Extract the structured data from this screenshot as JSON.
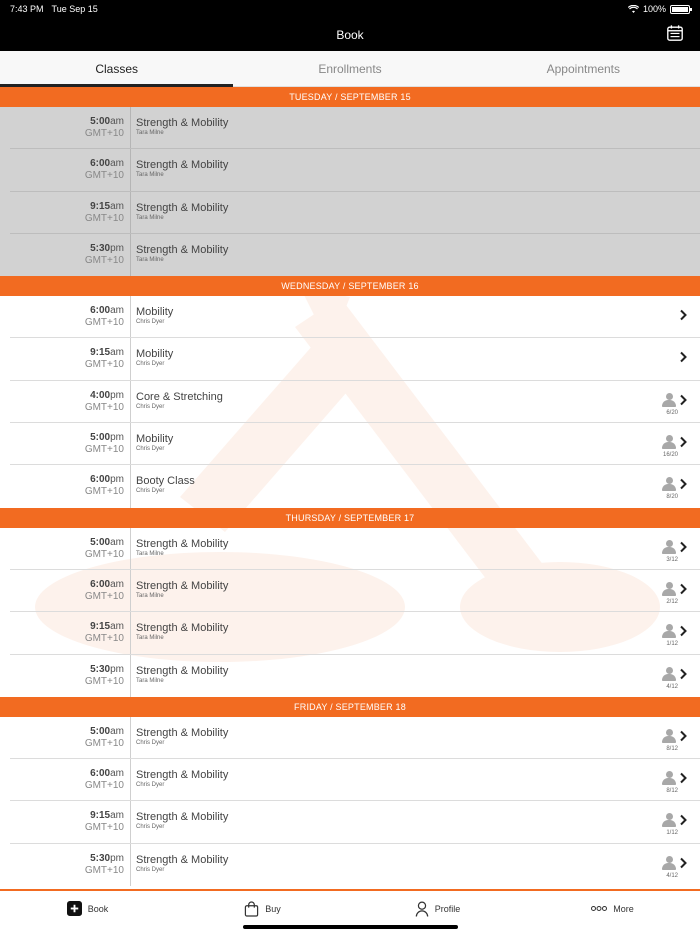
{
  "status_bar": {
    "time": "7:43 PM",
    "date": "Tue Sep 15",
    "battery": "100%"
  },
  "nav": {
    "title": "Book",
    "calendar_icon": "calendar-icon"
  },
  "tabs": [
    {
      "label": "Classes",
      "active": true
    },
    {
      "label": "Enrollments",
      "active": false
    },
    {
      "label": "Appointments",
      "active": false
    }
  ],
  "colors": {
    "accent": "#f26b21",
    "past_bg": "#d2d2d2",
    "bar_bg": "#000000"
  },
  "days": [
    {
      "header": "TUESDAY / SEPTEMBER 15",
      "past": true,
      "classes": [
        {
          "time": "5:00",
          "ampm": "am",
          "tz": "GMT+10",
          "name": "Strength & Mobility",
          "instructor": "Tara Milne",
          "show_person": false,
          "show_chevron": false,
          "count": ""
        },
        {
          "time": "6:00",
          "ampm": "am",
          "tz": "GMT+10",
          "name": "Strength & Mobility",
          "instructor": "Tara Milne",
          "show_person": false,
          "show_chevron": false,
          "count": ""
        },
        {
          "time": "9:15",
          "ampm": "am",
          "tz": "GMT+10",
          "name": "Strength & Mobility",
          "instructor": "Tara Milne",
          "show_person": false,
          "show_chevron": false,
          "count": ""
        },
        {
          "time": "5:30",
          "ampm": "pm",
          "tz": "GMT+10",
          "name": "Strength & Mobility",
          "instructor": "Tara Milne",
          "show_person": false,
          "show_chevron": false,
          "count": ""
        }
      ]
    },
    {
      "header": "WEDNESDAY / SEPTEMBER 16",
      "past": false,
      "classes": [
        {
          "time": "6:00",
          "ampm": "am",
          "tz": "GMT+10",
          "name": "Mobility",
          "instructor": "Chris Dyer",
          "show_person": false,
          "show_chevron": true,
          "count": ""
        },
        {
          "time": "9:15",
          "ampm": "am",
          "tz": "GMT+10",
          "name": "Mobility",
          "instructor": "Chris Dyer",
          "show_person": false,
          "show_chevron": true,
          "count": ""
        },
        {
          "time": "4:00",
          "ampm": "pm",
          "tz": "GMT+10",
          "name": "Core & Stretching",
          "instructor": "Chris Dyer",
          "show_person": true,
          "show_chevron": true,
          "count": "6/20"
        },
        {
          "time": "5:00",
          "ampm": "pm",
          "tz": "GMT+10",
          "name": "Mobility",
          "instructor": "Chris Dyer",
          "show_person": true,
          "show_chevron": true,
          "count": "16/20"
        },
        {
          "time": "6:00",
          "ampm": "pm",
          "tz": "GMT+10",
          "name": "Booty Class",
          "instructor": "Chris Dyer",
          "show_person": true,
          "show_chevron": true,
          "count": "8/20"
        }
      ]
    },
    {
      "header": "THURSDAY / SEPTEMBER 17",
      "past": false,
      "classes": [
        {
          "time": "5:00",
          "ampm": "am",
          "tz": "GMT+10",
          "name": "Strength & Mobility",
          "instructor": "Tara Milne",
          "show_person": true,
          "show_chevron": true,
          "count": "3/12"
        },
        {
          "time": "6:00",
          "ampm": "am",
          "tz": "GMT+10",
          "name": "Strength & Mobility",
          "instructor": "Tara Milne",
          "show_person": true,
          "show_chevron": true,
          "count": "2/12"
        },
        {
          "time": "9:15",
          "ampm": "am",
          "tz": "GMT+10",
          "name": "Strength & Mobility",
          "instructor": "Tara Milne",
          "show_person": true,
          "show_chevron": true,
          "count": "1/12"
        },
        {
          "time": "5:30",
          "ampm": "pm",
          "tz": "GMT+10",
          "name": "Strength & Mobility",
          "instructor": "Tara Milne",
          "show_person": true,
          "show_chevron": true,
          "count": "4/12"
        }
      ]
    },
    {
      "header": "FRIDAY / SEPTEMBER 18",
      "past": false,
      "classes": [
        {
          "time": "5:00",
          "ampm": "am",
          "tz": "GMT+10",
          "name": "Strength & Mobility",
          "instructor": "Chris Dyer",
          "show_person": true,
          "show_chevron": true,
          "count": "8/12"
        },
        {
          "time": "6:00",
          "ampm": "am",
          "tz": "GMT+10",
          "name": "Strength & Mobility",
          "instructor": "Chris Dyer",
          "show_person": true,
          "show_chevron": true,
          "count": "8/12"
        },
        {
          "time": "9:15",
          "ampm": "am",
          "tz": "GMT+10",
          "name": "Strength & Mobility",
          "instructor": "Chris Dyer",
          "show_person": true,
          "show_chevron": true,
          "count": "1/12"
        },
        {
          "time": "5:30",
          "ampm": "pm",
          "tz": "GMT+10",
          "name": "Strength & Mobility",
          "instructor": "Chris Dyer",
          "show_person": true,
          "show_chevron": true,
          "count": "4/12"
        }
      ]
    }
  ],
  "bottom_tabs": [
    {
      "label": "Book",
      "icon": "plus-square-icon"
    },
    {
      "label": "Buy",
      "icon": "bag-icon"
    },
    {
      "label": "Profile",
      "icon": "person-icon"
    },
    {
      "label": "More",
      "icon": "more-dots-icon"
    }
  ]
}
